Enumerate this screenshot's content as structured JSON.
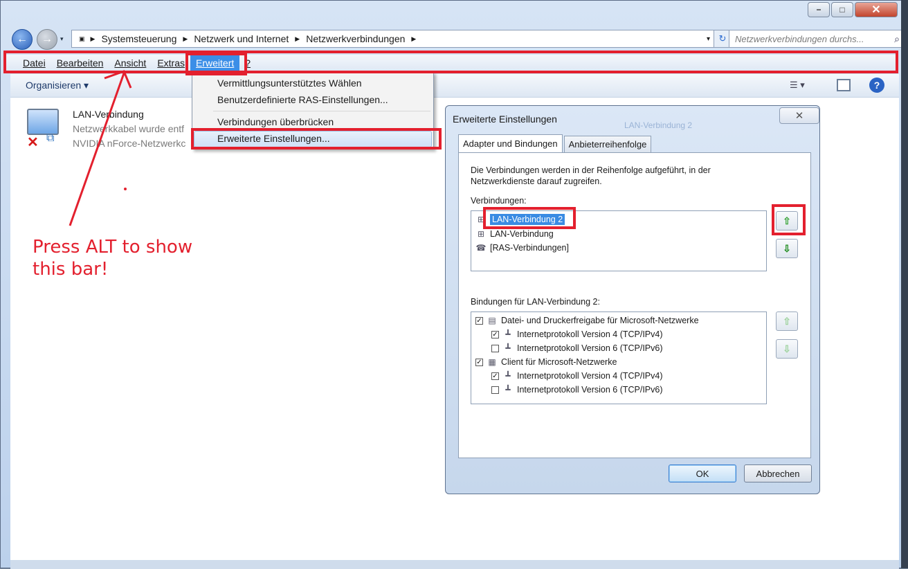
{
  "window": {
    "caption_buttons": {
      "minimize": "−",
      "maximize": "□",
      "close": "✕"
    }
  },
  "nav": {
    "back_icon": "←",
    "forward_icon": "→",
    "dropdown_icon": "▾",
    "address": [
      "Systemsteuerung",
      "Netzwerk und Internet",
      "Netzwerkverbindungen"
    ],
    "refresh_icon": "↻",
    "search_placeholder": "Netzwerkverbindungen durchs...",
    "search_icon": "⌕"
  },
  "menubar": {
    "items": [
      "Datei",
      "Bearbeiten",
      "Ansicht",
      "Extras",
      "Erweitert",
      "?"
    ],
    "active": "Erweitert"
  },
  "commandbar": {
    "organize": "Organisieren ▾",
    "views_icon": "☰ ▾",
    "help_icon": "?"
  },
  "connection": {
    "name": "LAN-Verbindung",
    "status": "Netzwerkkabel wurde entf",
    "device": "NVIDIA nForce-Netzwerkc",
    "disconnected_icon": "✕"
  },
  "dropdown_menu": {
    "items": [
      "Vermittlungsunterstütztes Wählen",
      "Benutzerdefinierte RAS-Einstellungen...",
      "Verbindungen überbrücken",
      "Erweiterte Einstellungen..."
    ],
    "highlighted": "Erweiterte Einstellungen..."
  },
  "annotation": {
    "line1": "Press ALT to show",
    "line2": "this bar!",
    "color": "#e3202e"
  },
  "dialog": {
    "title": "Erweiterte Einstellungen",
    "close_icon": "✕",
    "background_ghost_text": "LAN-Verbindung 2",
    "tabs": [
      "Adapter und Bindungen",
      "Anbieterreihenfolge"
    ],
    "selected_tab": "Adapter und Bindungen",
    "description_line1": "Die Verbindungen werden in der Reihenfolge aufgeführt, in der",
    "description_line2": "Netzwerkdienste darauf zugreifen.",
    "connections_label": "Verbindungen:",
    "connections": [
      "LAN-Verbindung 2",
      "LAN-Verbindung",
      "[RAS-Verbindungen]"
    ],
    "selected_connection": "LAN-Verbindung 2",
    "bindings_label": "Bindungen für LAN-Verbindung 2:",
    "bindings": [
      {
        "label": "Datei- und Druckerfreigabe für Microsoft-Netzwerke",
        "checked": true,
        "level": 0
      },
      {
        "label": "Internetprotokoll Version 4 (TCP/IPv4)",
        "checked": true,
        "level": 1
      },
      {
        "label": "Internetprotokoll Version 6 (TCP/IPv6)",
        "checked": false,
        "level": 1
      },
      {
        "label": "Client für Microsoft-Netzwerke",
        "checked": true,
        "level": 0
      },
      {
        "label": "Internetprotokoll Version 4 (TCP/IPv4)",
        "checked": true,
        "level": 1
      },
      {
        "label": "Internetprotokoll Version 6 (TCP/IPv6)",
        "checked": false,
        "level": 1
      }
    ],
    "move_up_icon": "⇧",
    "move_down_icon": "⇩",
    "ok": "OK",
    "cancel": "Abbrechen"
  }
}
